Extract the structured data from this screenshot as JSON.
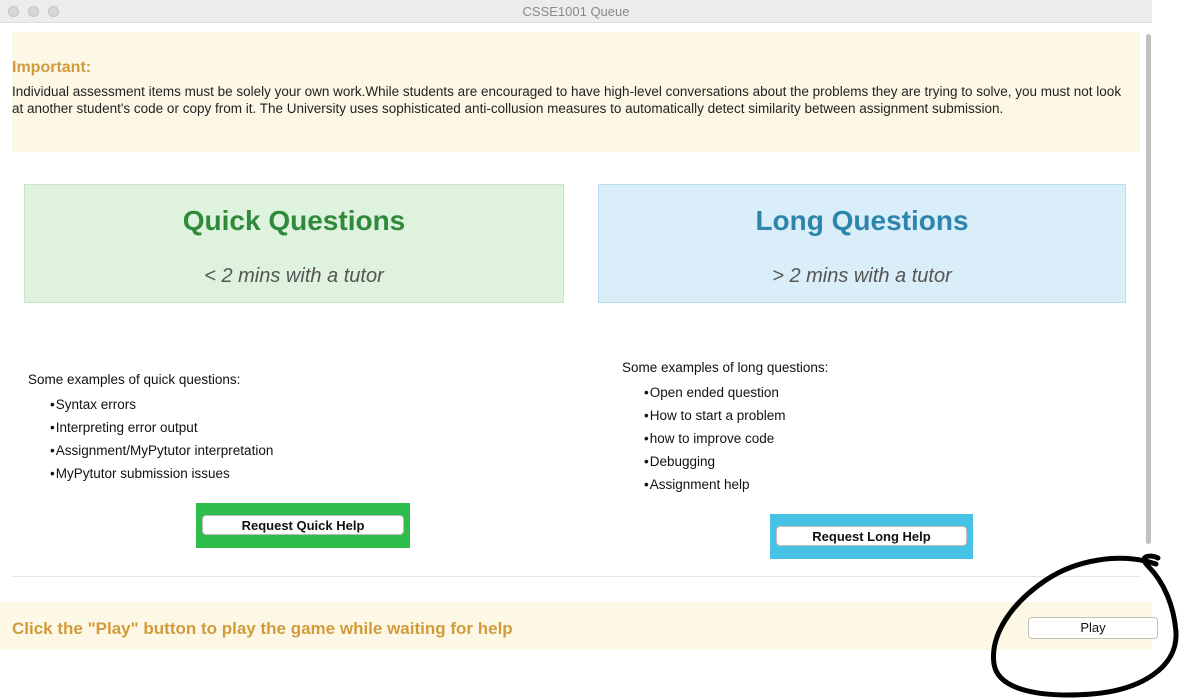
{
  "window": {
    "title": "CSSE1001 Queue"
  },
  "notice": {
    "heading": "Important:",
    "body": "Individual assessment items must be solely your own work.While students are encouraged to have high-level conversations about the problems they are trying to solve, you must not look at another student's code or copy from it. The University uses sophisticated anti-collusion measures to automatically detect similarity between assignment submission."
  },
  "quick": {
    "title": "Quick Questions",
    "subtitle": "< 2 mins with a tutor",
    "intro": "Some examples of quick questions:",
    "examples": [
      "Syntax errors",
      "Interpreting error output",
      "Assignment/MyPytutor interpretation",
      "MyPytutor submission issues"
    ],
    "button_label": "Request Quick Help"
  },
  "long": {
    "title": "Long Questions",
    "subtitle": "> 2 mins with a tutor",
    "intro": "Some examples of long questions:",
    "examples": [
      "Open ended question",
      "How to start a problem",
      "how to improve code",
      "Debugging",
      "Assignment help"
    ],
    "button_label": "Request Long Help"
  },
  "footer": {
    "text": "Click the \"Play\" button to play the game while waiting for help",
    "play_label": "Play"
  },
  "colors": {
    "accent_gold": "#d19b3c",
    "quick_green": "#2ebd4a",
    "long_blue": "#48c2e4"
  }
}
